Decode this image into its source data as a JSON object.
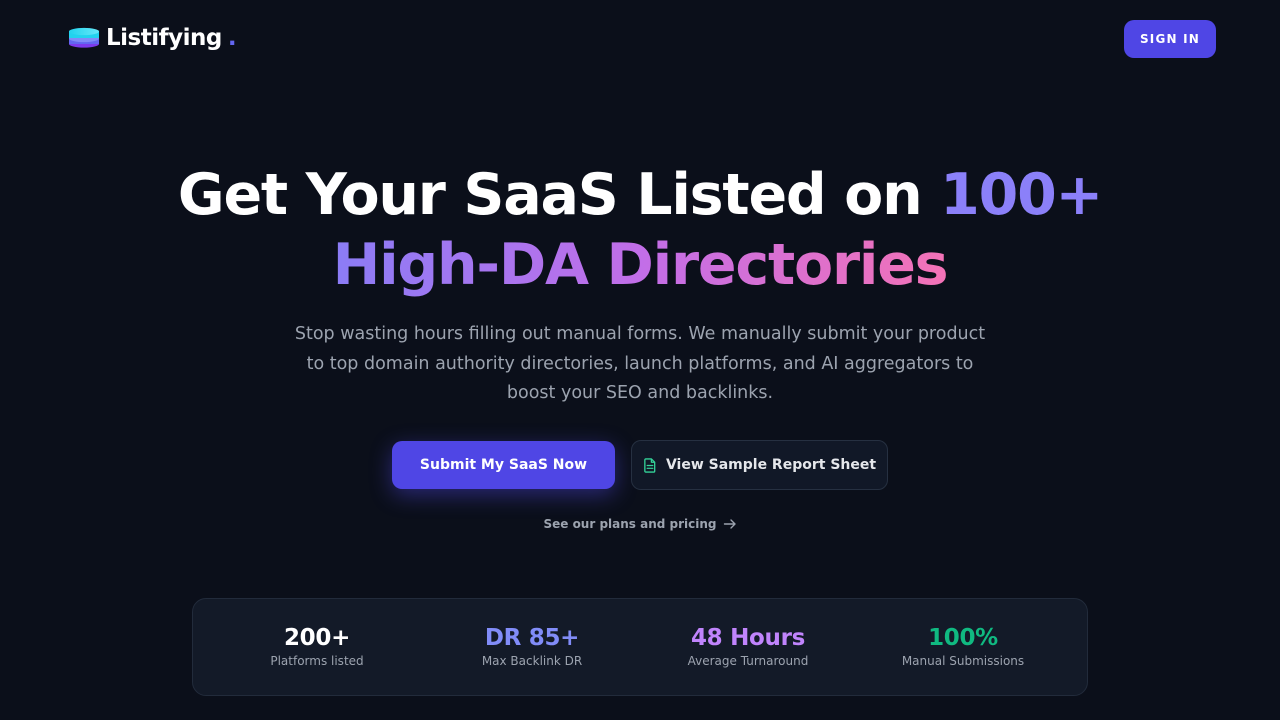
{
  "brand": {
    "name": "Listifying",
    "dot": ".",
    "accent": "#6366f1"
  },
  "header": {
    "signin_label": "SIGN IN"
  },
  "hero": {
    "headline_part1": "Get Your SaaS Listed on ",
    "headline_accent": "100+",
    "headline_line2": "High-DA Directories",
    "subtitle": "Stop wasting hours filling out manual forms. We manually submit your product to top domain authority directories, launch platforms, and AI aggregators to boost your SEO and backlinks.",
    "primary_cta": "Submit My SaaS Now",
    "secondary_cta": "View Sample Report Sheet",
    "pricing_link": "See our plans and pricing"
  },
  "stats": [
    {
      "value": "200+",
      "label": "Platforms listed",
      "color": "#ffffff"
    },
    {
      "value": "DR 85+",
      "label": "Max Backlink DR",
      "color": "#818cf8"
    },
    {
      "value": "48 Hours",
      "label": "Average Turnaround",
      "color": "#c084fc"
    },
    {
      "value": "100%",
      "label": "Manual Submissions",
      "color": "#10b981"
    }
  ],
  "icons": {
    "logo": "stacked-layers-icon",
    "secondary_cta": "document-icon",
    "pricing_link": "arrow-right-icon"
  },
  "colors": {
    "background": "#0b0f1a",
    "primary": "#4f46e5",
    "gradient_start": "#8b7cf6",
    "gradient_end": "#f472b6",
    "document_icon": "#34d399"
  }
}
